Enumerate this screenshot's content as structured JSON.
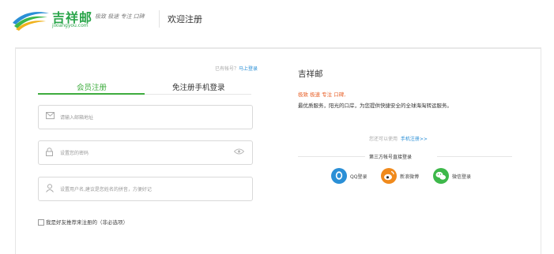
{
  "header": {
    "logo_text": "吉祥邮",
    "logo_domain": "jixiangyou.com",
    "slogan": "极致 极速 专注 口碑",
    "page_title": "欢迎注册"
  },
  "login_hint": {
    "prefix": "已有帐号？",
    "link": "马上登录"
  },
  "tabs": [
    {
      "label": "会员注册",
      "active": true
    },
    {
      "label": "免注册手机登录",
      "active": false
    }
  ],
  "form": {
    "email_placeholder": "请输入邮箱地址",
    "password_placeholder": "设置您的密码",
    "username_placeholder": "设置用户名,建议是您姓名的拼音，方便好记",
    "referral_label": "我是好友推荐来注册的（非必选项）"
  },
  "promo": {
    "title": "吉祥邮",
    "tagline": "极致 极速 专注 口碑,",
    "description": "最优质服务，阳光的口岸，为您提供快捷安全的全球海淘转运服务。",
    "alt_register_prefix": "您还可以使用",
    "alt_register_link": "手机注册>>",
    "third_party_label": "第三方帐号直接登录",
    "social": [
      {
        "label": "QQ登录",
        "color": "#2a8fd6"
      },
      {
        "label": "新浪微博",
        "color": "#f08a1c"
      },
      {
        "label": "微信登录",
        "color": "#3db84a"
      }
    ]
  },
  "colors": {
    "brand_green": "#2aa54a",
    "active_tab": "#3eac3e",
    "link_blue": "#2a8fd6",
    "tagline_orange": "#e8622a"
  }
}
